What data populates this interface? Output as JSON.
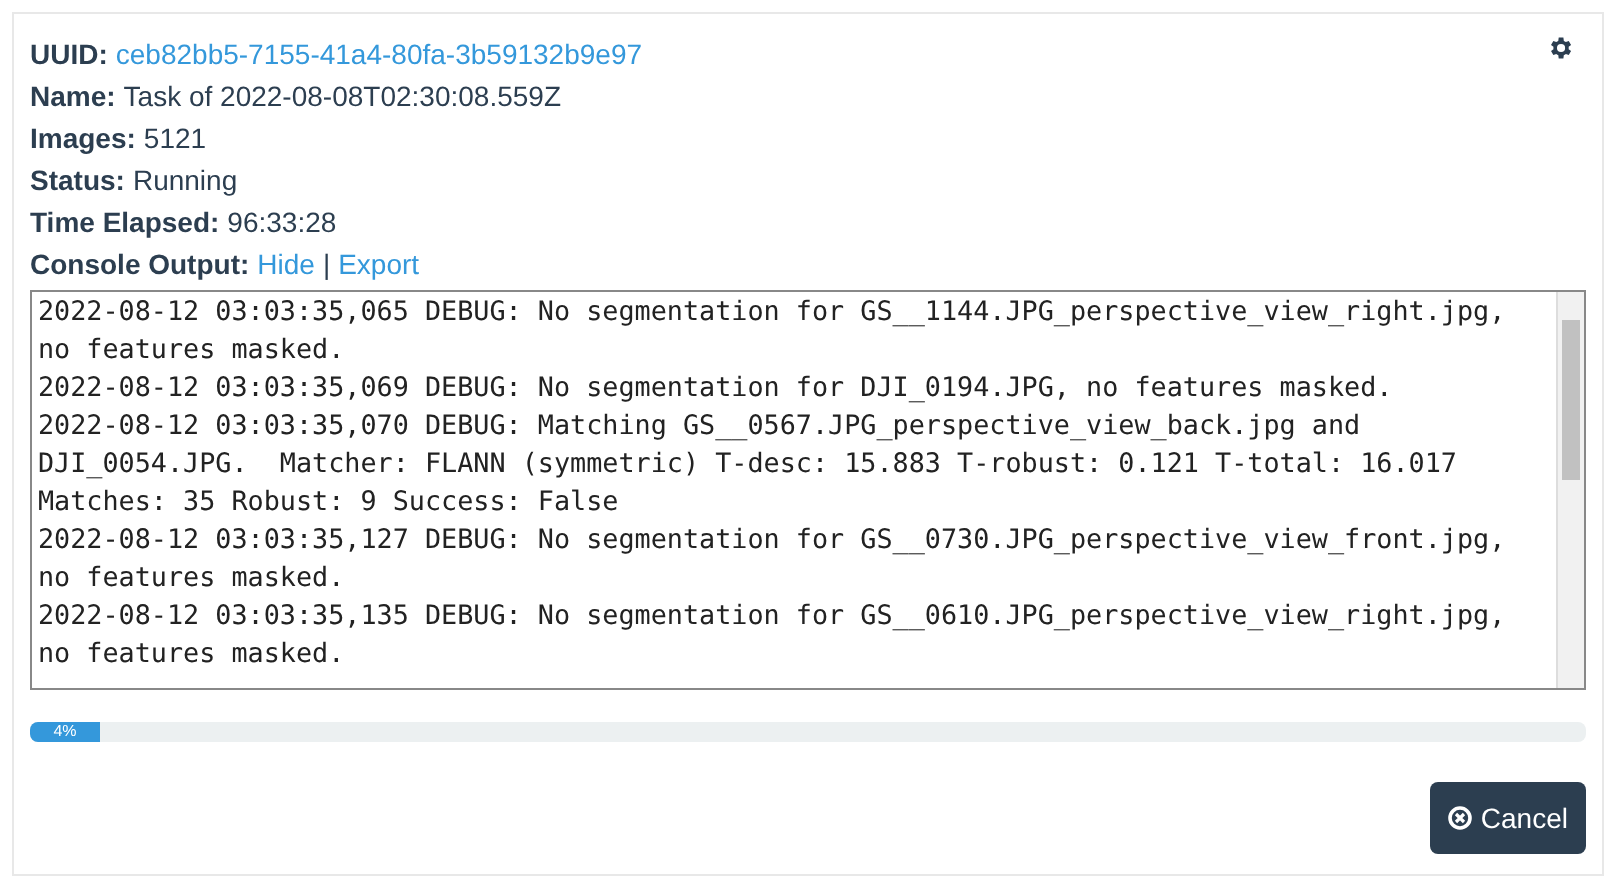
{
  "task": {
    "uuid_label": "UUID:",
    "uuid": "ceb82bb5-7155-41a4-80fa-3b59132b9e97",
    "fields": [
      {
        "label": "Name:",
        "value": "Task of 2022-08-08T02:30:08.559Z"
      },
      {
        "label": "Images:",
        "value": "5121"
      },
      {
        "label": "Status:",
        "value": "Running"
      },
      {
        "label": "Time Elapsed:",
        "value": "96:33:28"
      }
    ],
    "console_label": "Console Output:",
    "console_links": [
      "Hide",
      "Export"
    ],
    "console_separator": "|"
  },
  "console_lines": [
    "2022-08-12 03:03:35,065 DEBUG: No segmentation for GS__1144.JPG_perspective_view_right.jpg,",
    "no features masked.",
    "2022-08-12 03:03:35,069 DEBUG: No segmentation for DJI_0194.JPG, no features masked.",
    "2022-08-12 03:03:35,070 DEBUG: Matching GS__0567.JPG_perspective_view_back.jpg and",
    "DJI_0054.JPG.  Matcher: FLANN (symmetric) T-desc: 15.883 T-robust: 0.121 T-total: 16.017",
    "Matches: 35 Robust: 9 Success: False",
    "2022-08-12 03:03:35,127 DEBUG: No segmentation for GS__0730.JPG_perspective_view_front.jpg,",
    "no features masked.",
    "2022-08-12 03:03:35,135 DEBUG: No segmentation for GS__0610.JPG_perspective_view_right.jpg,",
    "no features masked."
  ],
  "progress": {
    "level": 0.04,
    "label": "4%"
  },
  "cancel_button": {
    "label": "Cancel"
  }
}
